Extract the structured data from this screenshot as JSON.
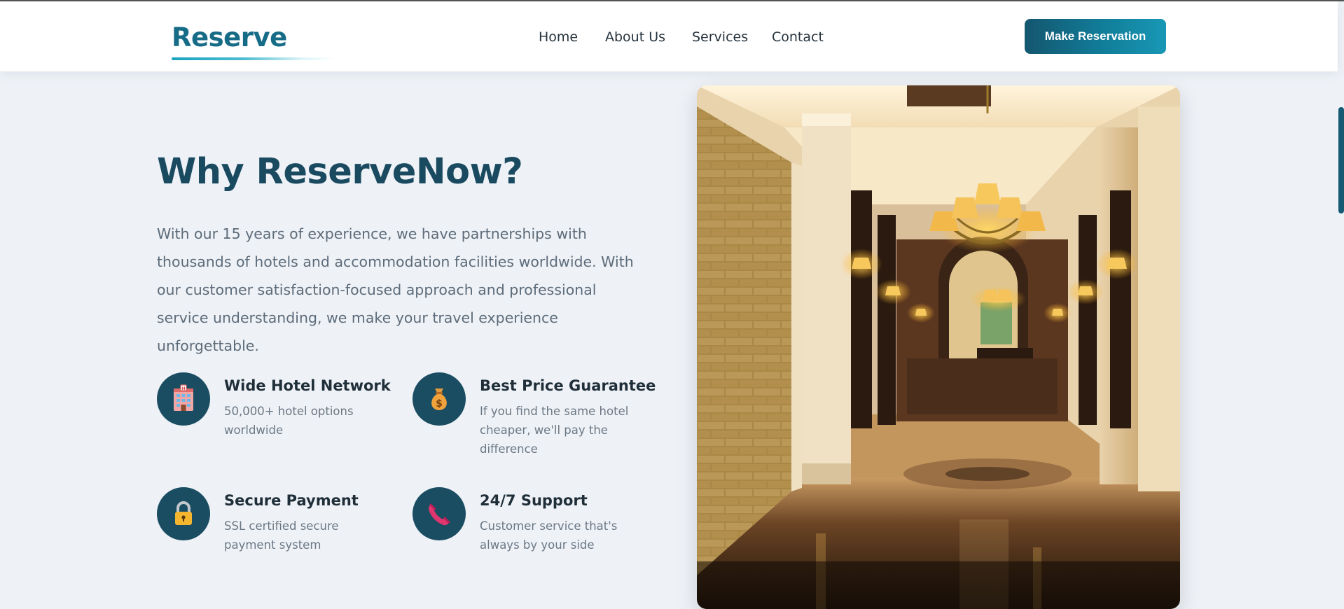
{
  "header": {
    "logo": "Reserve",
    "nav": [
      {
        "label": "Home"
      },
      {
        "label": "About Us"
      },
      {
        "label": "Services"
      },
      {
        "label": "Contact"
      }
    ],
    "cta_label": "Make Reservation"
  },
  "colors": {
    "brand": "#166b86",
    "heading": "#1a4a5f",
    "icon_circle": "#1a4d62",
    "page_background": "#eef2f7"
  },
  "main": {
    "title": "Why ReserveNow?",
    "intro": "With our 15 years of experience, we have partnerships with thousands of hotels and accommodation facilities worldwide. With our customer satisfaction-focused approach and professional service understanding, we make your travel experience unforgettable.",
    "features": [
      {
        "icon": "hotel-icon",
        "title": "Wide Hotel Network",
        "desc": "50,000+ hotel options worldwide"
      },
      {
        "icon": "money-bag-icon",
        "title": "Best Price Guarantee",
        "desc": "If you find the same hotel cheaper, we'll pay the difference"
      },
      {
        "icon": "lock-icon",
        "title": "Secure Payment",
        "desc": "SSL certified secure payment system"
      },
      {
        "icon": "phone-icon",
        "title": "24/7 Support",
        "desc": "Customer service that's always by your side"
      }
    ]
  }
}
